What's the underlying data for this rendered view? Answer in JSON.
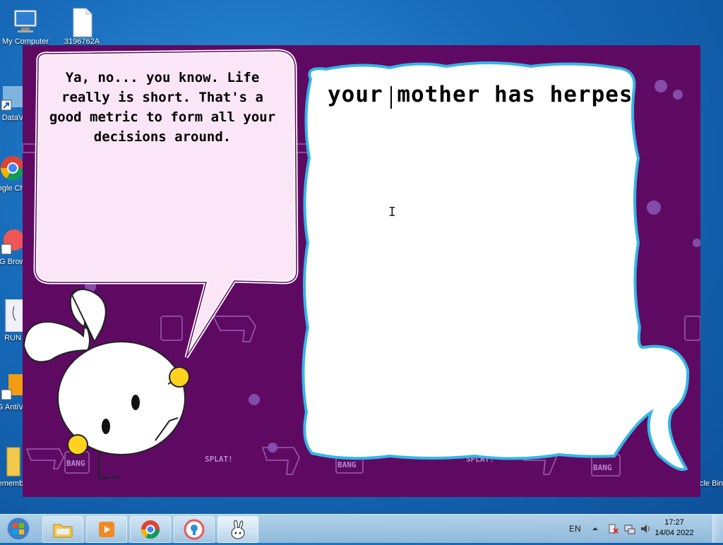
{
  "desktop": {
    "icons": [
      {
        "label": "My Computer"
      },
      {
        "label": "3196762A"
      },
      {
        "label": "DataV"
      },
      {
        "label": "Google Chrome"
      },
      {
        "label": "AVG Browser"
      },
      {
        "label": "RUN"
      },
      {
        "label": "AVG AntiVirus Free"
      },
      {
        "label": "remember"
      },
      {
        "label": "Recycle Bin"
      }
    ]
  },
  "app": {
    "speech_bubble_text": "Ya, no... you know. Life really is short. That's a good metric to form all your decisions around.",
    "reply_text": "your mother has herpes",
    "background_stamps": [
      "BANG",
      "SPLAT!",
      "BANG",
      "SPLAT!",
      "BANG"
    ],
    "colors": {
      "background": "#5e0a63",
      "bubble_fill": "#fbe6f7",
      "reply_outline": "#35b6e6"
    }
  },
  "taskbar": {
    "start_icon": "windows-logo-icon",
    "pinned": [
      {
        "name": "file-explorer-icon"
      },
      {
        "name": "media-player-icon"
      },
      {
        "name": "chrome-icon"
      },
      {
        "name": "avg-browser-icon"
      },
      {
        "name": "bunny-app-icon",
        "active": true
      }
    ],
    "language": "EN",
    "time": "17:27",
    "date": "14/04 2022"
  }
}
